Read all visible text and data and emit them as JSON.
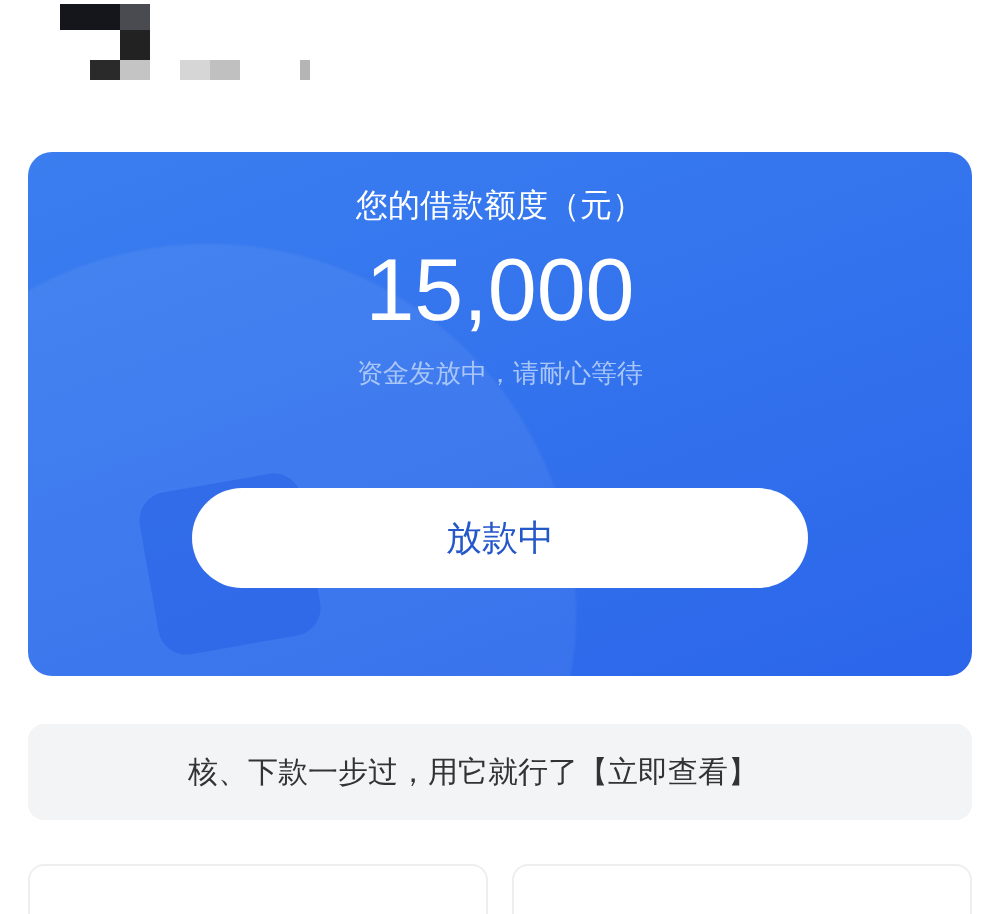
{
  "loan_card": {
    "title": "您的借款额度（元）",
    "amount": "15,000",
    "status_text": "资金发放中，请耐心等待",
    "button": "放款中"
  },
  "banner": {
    "text": "核、下款一步过，用它就行了【立即查看】"
  }
}
